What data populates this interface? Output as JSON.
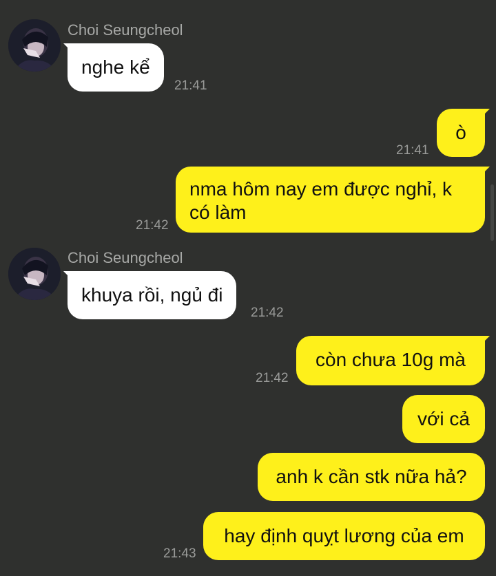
{
  "contact": {
    "name": "Choi Seungcheol"
  },
  "messages": [
    {
      "direction": "in",
      "text": "nghe kể",
      "time": "21:41"
    },
    {
      "direction": "out",
      "text": "ò",
      "time": "21:41"
    },
    {
      "direction": "out",
      "text": "nma hôm nay em được nghỉ, k có làm",
      "time": "21:42"
    },
    {
      "direction": "in",
      "text": "khuya rồi, ngủ đi",
      "time": "21:42"
    },
    {
      "direction": "out",
      "text": "còn chưa 10g mà",
      "time": "21:42"
    },
    {
      "direction": "out",
      "text": "với cả",
      "time": ""
    },
    {
      "direction": "out",
      "text": "anh k cần stk nữa hả?",
      "time": ""
    },
    {
      "direction": "out",
      "text": "hay định quỵt lương của em",
      "time": "21:43"
    }
  ],
  "colors": {
    "background": "#2f302e",
    "incoming_bubble": "#ffffff",
    "outgoing_bubble": "#fef01b",
    "timestamp": "#9a9b99",
    "sender_name": "#a7a8a6"
  },
  "icons": {
    "avatar": "profile-photo-avatar"
  }
}
